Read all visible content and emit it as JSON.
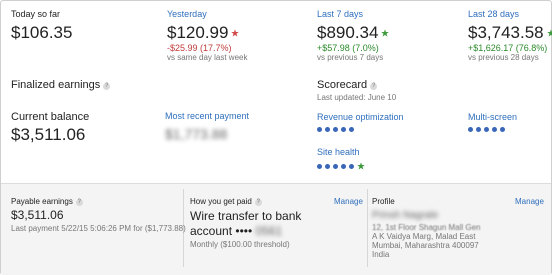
{
  "summary": {
    "today": {
      "label": "Today so far",
      "value": "$106.35"
    },
    "yesterday": {
      "label": "Yesterday",
      "value": "$120.99",
      "change": "-$25.99 (17.7%)",
      "compare": "vs same day last week"
    },
    "last7": {
      "label": "Last 7 days",
      "value": "$890.34",
      "change": "+$57.98 (7.0%)",
      "compare": "vs previous 7 days"
    },
    "last28": {
      "label": "Last 28 days",
      "value": "$3,743.58",
      "change": "+$1,626.17 (76.8%)",
      "compare": "vs previous 28 days"
    }
  },
  "finalized": {
    "title": "Finalized earnings",
    "current_balance_label": "Current balance",
    "current_balance_value": "$3,511.06",
    "recent_payment_label": "Most recent payment",
    "recent_payment_value": "$1,773.88"
  },
  "scorecard": {
    "title": "Scorecard",
    "updated": "Last updated: June 10",
    "revenue_label": "Revenue optimization",
    "multiscreen_label": "Multi-screen",
    "sitehealth_label": "Site health"
  },
  "bottom": {
    "payable": {
      "label": "Payable earnings",
      "value": "$3,511.06",
      "last_payment": "Last payment 5/22/15 5:06:26 PM for ($1,773.88)"
    },
    "paid": {
      "label": "How you get paid",
      "manage": "Manage",
      "method_line1": "Wire transfer to bank",
      "method_line2": "account ••••",
      "method_masked": "0561",
      "threshold": "Monthly ($100.00 threshold)"
    },
    "profile": {
      "label": "Profile",
      "manage": "Manage",
      "name": "Prinsh Nagrale",
      "address1": "12, 1st Floor Shagun Mall Gen",
      "address2": "A K Vaidya Marg, Malad East",
      "address3": "Mumbai, Maharashtra 400097",
      "country": "India"
    }
  },
  "colors": {
    "link": "#2f6fbd",
    "positive": "#2b8a2b",
    "negative": "#c23b3b",
    "dot": "#3a66b8"
  },
  "icons": {
    "help": "question-circle-icon",
    "up": "green-star-icon",
    "down": "red-star-icon"
  }
}
